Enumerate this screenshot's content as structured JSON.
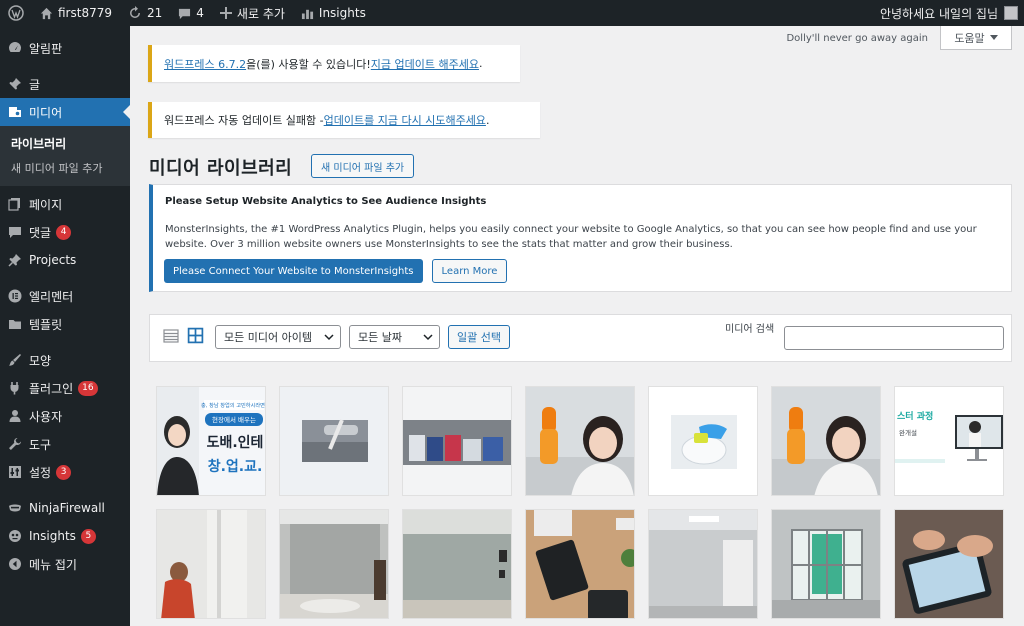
{
  "adminbar": {
    "site_name": "first8779",
    "updates_count": "21",
    "comments_count": "4",
    "new_label": "새로 추가",
    "insights_label": "Insights",
    "greeting": "안녕하세요 내일의 집님"
  },
  "sidebar": {
    "dashboard": "알림판",
    "posts": "글",
    "media": "미디어",
    "media_sub": {
      "library": "라이브러리",
      "add_new": "새 미디어 파일 추가"
    },
    "pages": "페이지",
    "comments": "댓글",
    "comments_badge": "4",
    "projects": "Projects",
    "elementor": "엘리멘터",
    "templates": "템플릿",
    "appearance": "모양",
    "plugins": "플러그인",
    "plugins_badge": "16",
    "users": "사용자",
    "tools": "도구",
    "settings": "설정",
    "settings_badge": "3",
    "ninjafirewall": "NinjaFirewall",
    "insights": "Insights",
    "insights_badge": "5",
    "collapse": "메뉴 접기"
  },
  "header": {
    "dolly": "Dolly'll never go away again",
    "help": "도움말"
  },
  "notices": {
    "update_link": "워드프레스 6.7.2",
    "update_mid": "을(를) 사용할 수 있습니다!",
    "update_now": "지금 업데이트 해주세요",
    "update_end": ".",
    "failed_prefix": "워드프레스 자동 업데이트 실패함 - ",
    "failed_link": "업데이트를 지금 다시 시도해주세요",
    "failed_end": "."
  },
  "page": {
    "title": "미디어 라이브러리",
    "add_new": "새 미디어 파일 추가"
  },
  "monsterinsights": {
    "title": "Please Setup Website Analytics to See Audience Insights",
    "text": "MonsterInsights, the #1 WordPress Analytics Plugin, helps you easily connect your website to Google Analytics, so that you can see how people find and use your website. Over 3 million website owners use MonsterInsights to see the stats that matter and grow their business.",
    "connect": "Please Connect Your Website to MonsterInsights",
    "learn_more": "Learn More"
  },
  "toolbar": {
    "filter_type": "모든 미디어 아이템",
    "filter_date": "모든 날짜",
    "bulk_select": "일괄 선택",
    "search_label": "미디어 검색",
    "search_value": ""
  },
  "thumbnails": {
    "t1_line1": "충, 창남 창업의 고민하시라면!",
    "t1_line2": "현장에서 배우는",
    "t1_line3": "도배.인테",
    "t1_line4": "창.업.교.",
    "t7_line1": "스터 과정",
    "t7_line2": "완개설"
  },
  "colors": {
    "adminbar_bg": "#1d2327",
    "accent": "#2271b1",
    "warning": "#dba617",
    "badge": "#d63638"
  }
}
